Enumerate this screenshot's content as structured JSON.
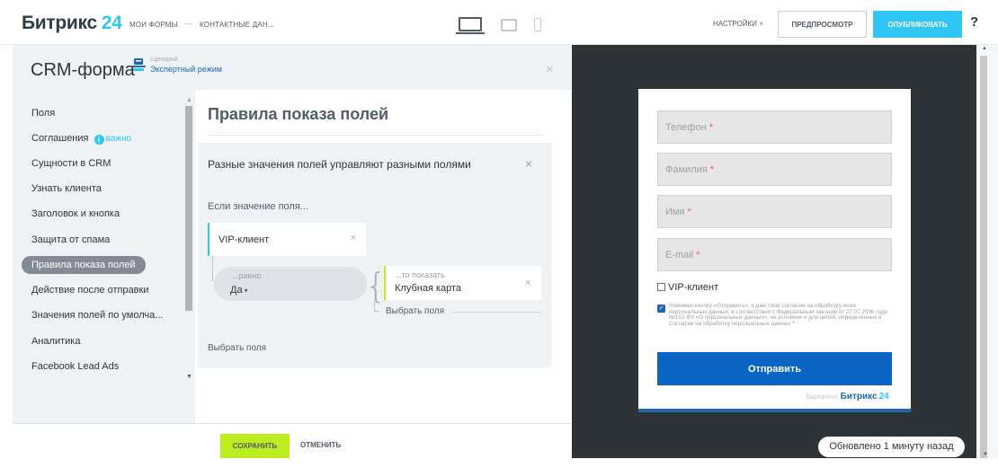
{
  "header": {
    "logo_text": "Битрикс",
    "logo_num": "24",
    "crumb_forms": "МОИ ФОРМЫ",
    "crumb_sep": "—",
    "crumb_current": "КОНТАКТНЫЕ ДАН...",
    "settings": "НАСТРОЙКИ",
    "settings_chevron": "▾",
    "preview": "ПРЕДПРОСМОТР",
    "publish": "ОПУБЛИКОВАТЬ",
    "help": "?"
  },
  "panel": {
    "title": "CRM-форма",
    "scenario_caption": "сценарий",
    "scenario_mode": "Экспертный режим",
    "close": "×"
  },
  "nav": {
    "items": [
      {
        "label": "Поля"
      },
      {
        "label": "Соглашения",
        "badge": "важно"
      },
      {
        "label": "Сущности в CRM"
      },
      {
        "label": "Узнать клиента"
      },
      {
        "label": "Заголовок и кнопка"
      },
      {
        "label": "Защита от спама"
      },
      {
        "label": "Правила показа полей"
      },
      {
        "label": "Действие после отправки"
      },
      {
        "label": "Значения полей по умолча..."
      },
      {
        "label": "Аналитика"
      },
      {
        "label": "Facebook Lead Ads"
      }
    ],
    "active_index": 6
  },
  "content": {
    "title": "Правила показа полей",
    "rule": {
      "title": "Разные значения полей управляют разными полями",
      "close": "×",
      "if_label": "Если значение поля...",
      "field": "VIP-клиент",
      "field_remove": "×",
      "eq_caption": "...равно",
      "eq_value": "Да",
      "show_caption": "...то показать",
      "show_value": "Клубная карта",
      "show_remove": "×",
      "choose_inner": "Выбрать поля",
      "choose_outer": "Выбрать поля"
    }
  },
  "footer": {
    "save": "СОХРАНИТЬ",
    "cancel": "ОТМЕНИТЬ"
  },
  "preview": {
    "fields": [
      {
        "placeholder": "Телефон"
      },
      {
        "placeholder": "Фамилия"
      },
      {
        "placeholder": "Имя"
      },
      {
        "placeholder": "E-mail"
      }
    ],
    "required_mark": "*",
    "vip_label": "VIP-клиент",
    "consent_text": "Нажимая кнопку «Отправить», я даю свое согласие на обработку моих персональных данных, в соответствии с Федеральным законом от 27.07.2006 года №152-ФЗ «О персональных данных», на условиях и для целей, определенных в Согласии на обработку персональных данных",
    "submit": "Отправить",
    "powered_by": "Заряжено",
    "powered_brand": "Битрикс",
    "powered_num": "24",
    "updated": "Обновлено 1 минуту назад"
  },
  "colors": {
    "accent": "#2fc6f6",
    "save": "#bbed21",
    "submit": "#0b66c3",
    "preview_bg": "#2e3338"
  }
}
